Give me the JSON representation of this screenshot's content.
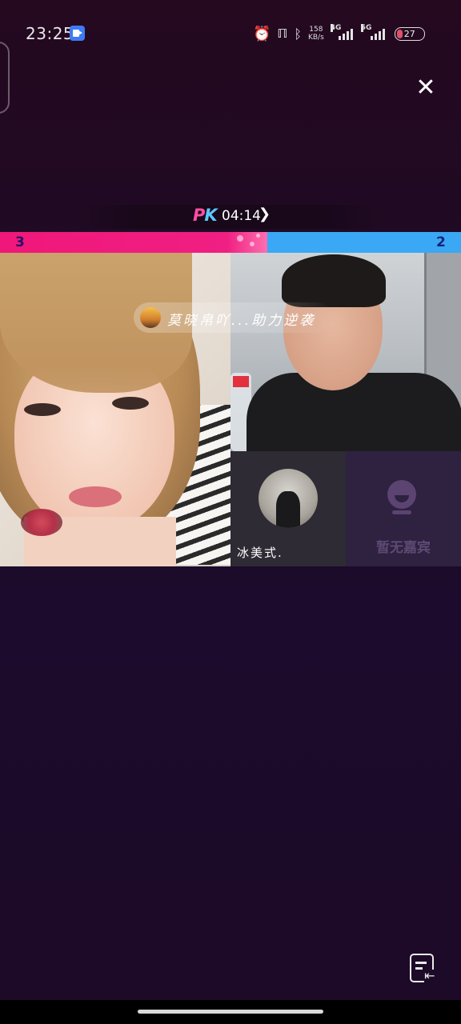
{
  "status_bar": {
    "time": "23:25",
    "net_speed_value": "158",
    "net_speed_unit": "KB/s",
    "sim1_type": "4G",
    "sim2_type": "5G",
    "battery_level": "27",
    "icons": [
      "screen-record-icon",
      "alarm-icon",
      "nfc-icon",
      "bluetooth-icon",
      "signal-icon",
      "battery-icon"
    ]
  },
  "pk": {
    "logo_p": "P",
    "logo_k": "K",
    "timer": "04:14",
    "left_score": "3",
    "right_score": "2",
    "colors": {
      "left": "#f0177a",
      "right": "#3aa8f4"
    }
  },
  "banner": {
    "text": "莫晓帛吖...助力逆袭"
  },
  "guest": {
    "name": "冰美式."
  },
  "empty_seat": {
    "label": "暂无嘉宾"
  }
}
